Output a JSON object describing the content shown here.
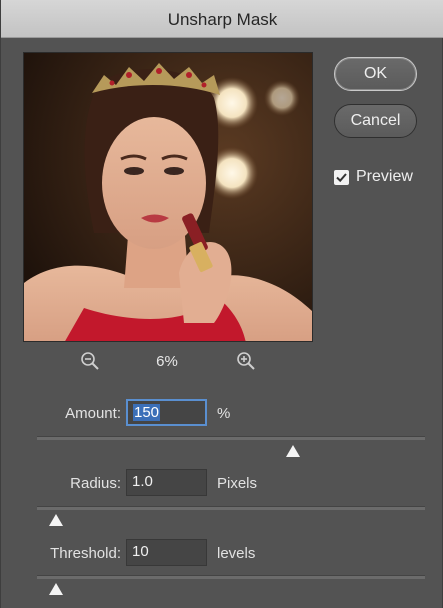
{
  "dialog": {
    "title": "Unsharp Mask"
  },
  "buttons": {
    "ok_label": "OK",
    "cancel_label": "Cancel"
  },
  "preview": {
    "label": "Preview",
    "checked": true
  },
  "zoom": {
    "level": "6%",
    "zoom_out_icon": "zoom-out-icon",
    "zoom_in_icon": "zoom-in-icon"
  },
  "params": {
    "amount": {
      "label": "Amount:",
      "value": "150",
      "unit": "%",
      "slider_fraction": 0.66
    },
    "radius": {
      "label": "Radius:",
      "value": "1.0",
      "unit": "Pixels",
      "slider_fraction": 0.05
    },
    "threshold": {
      "label": "Threshold:",
      "value": "10",
      "unit": "levels",
      "slider_fraction": 0.05
    }
  },
  "colors": {
    "dialog_bg": "#535353",
    "title_bg": "#c9c9c9",
    "selection": "#3b6fb8"
  }
}
